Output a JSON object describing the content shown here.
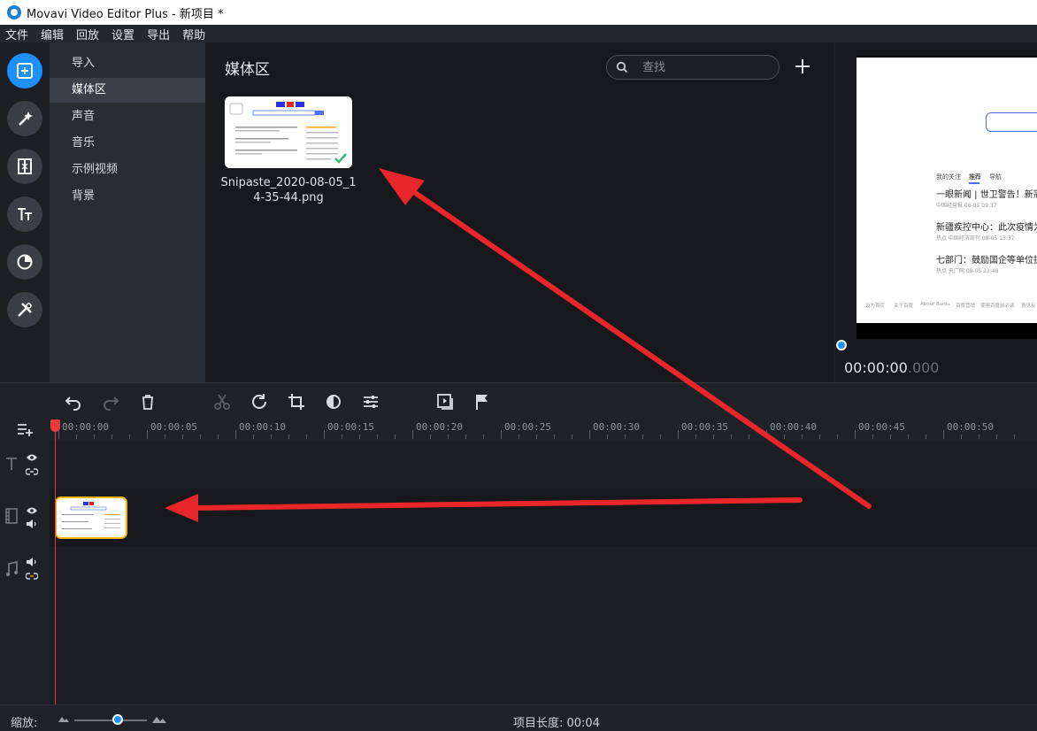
{
  "window": {
    "title": "Movavi Video Editor Plus - 新项目 *"
  },
  "menu": [
    "文件",
    "编辑",
    "回放",
    "设置",
    "导出",
    "帮助"
  ],
  "left_tools": [
    {
      "icon": "import-media-icon",
      "active": true
    },
    {
      "icon": "magic-wand-filters-icon",
      "active": false
    },
    {
      "icon": "transitions-icon",
      "active": false
    },
    {
      "icon": "titles-icon",
      "active": false
    },
    {
      "icon": "stickers-icon",
      "active": false
    },
    {
      "icon": "more-tools-icon",
      "active": false
    }
  ],
  "import_menu": {
    "items": [
      "导入",
      "媒体区",
      "声音",
      "音乐",
      "示例视频",
      "背景"
    ],
    "active_index": 1
  },
  "media_area": {
    "title": "媒体区",
    "search_placeholder": "查找",
    "file": {
      "name": "Snipaste_2020-08-05_14-35-44.png"
    }
  },
  "preview": {
    "tabs": [
      "我的关注",
      "推荐",
      "导航"
    ],
    "headlines": [
      {
        "title": "一眼新闻 | 世卫警告！新冠中",
        "meta": "中国经营报    08-05 09:37"
      },
      {
        "title": "新疆疾控中心：此次疫情为同",
        "meta": "热点    中国经济周刊    08-05 13:37"
      },
      {
        "title": "七部门：鼓励国企等单位扩大",
        "meta": "热点    央广网    08-05 12:48"
      }
    ],
    "footer": [
      "设为首页",
      "关于百度",
      "About Baidu",
      "百度营销",
      "使用百度前必读",
      "意见反"
    ],
    "timecode_main": "00:00:00",
    "timecode_ms": ".000"
  },
  "timeline": {
    "ruler_labels": [
      "00:00:00",
      "00:00:05",
      "00:00:10",
      "00:00:15",
      "00:00:20",
      "00:00:25",
      "00:00:30",
      "00:00:35",
      "00:00:40",
      "00:00:45",
      "00:00:50"
    ]
  },
  "status": {
    "zoom_label": "缩放:",
    "zoom_level": 0.6,
    "duration": "项目长度: 00:04"
  },
  "colors": {
    "accent": "#1e90ff",
    "clip_border": "#f5b800",
    "playhead": "#e83a3a",
    "annotation_arrow": "#e8262a"
  }
}
